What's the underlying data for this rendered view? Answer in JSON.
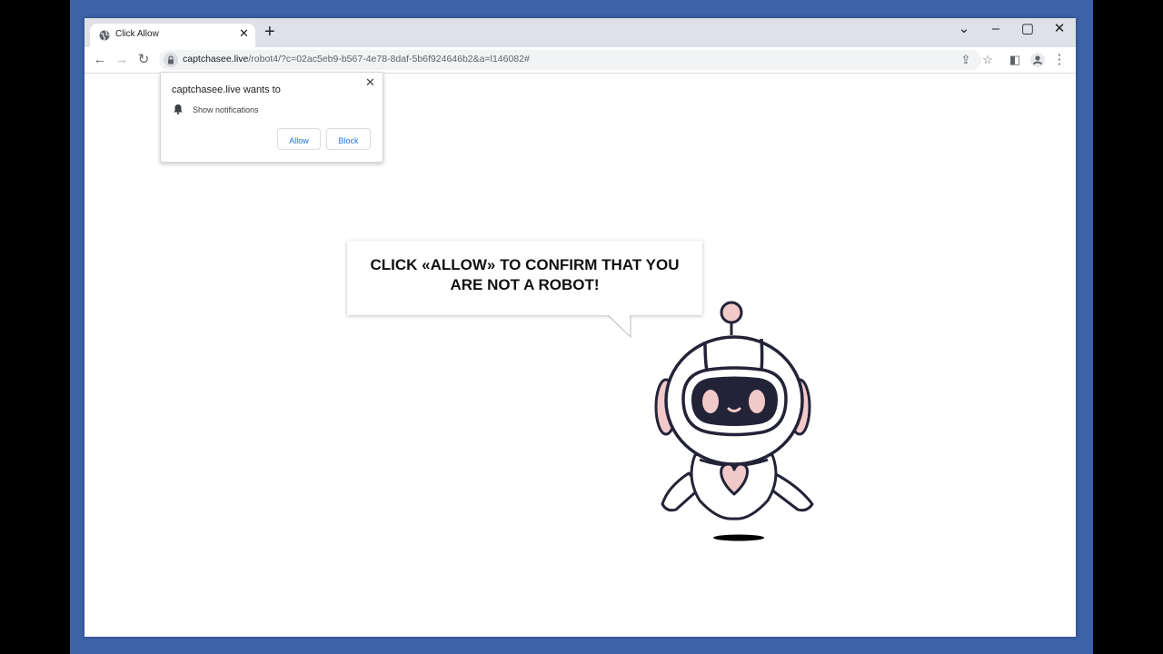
{
  "tab": {
    "title": "Click Allow",
    "close_glyph": "✕"
  },
  "newtab_glyph": "+",
  "window_controls": {
    "dropdown": "⌄",
    "minimize": "–",
    "maximize": "▢",
    "close": "✕"
  },
  "nav": {
    "back": "←",
    "forward": "→",
    "reload": "↻"
  },
  "address": {
    "host": "captchasee.live",
    "path": "/robot4/?c=02ac5eb9-b567-4e78-8daf-5b6f924646b2&a=l146082#"
  },
  "toolbar_icons": {
    "share": "⇪",
    "star": "☆",
    "sidepanel": "◧",
    "menu": "⋮"
  },
  "permission_popup": {
    "heading": "captchasee.live wants to",
    "permission": "Show notifications",
    "allow_label": "Allow",
    "block_label": "Block",
    "close_glyph": "✕"
  },
  "page": {
    "message": "CLICK «ALLOW» TO CONFIRM THAT YOU ARE NOT A ROBOT!"
  },
  "colors": {
    "desktop": "#3d63a8",
    "robot_outline": "#232338",
    "robot_pink": "#f2c9c9",
    "link_blue": "#1a73e8"
  }
}
